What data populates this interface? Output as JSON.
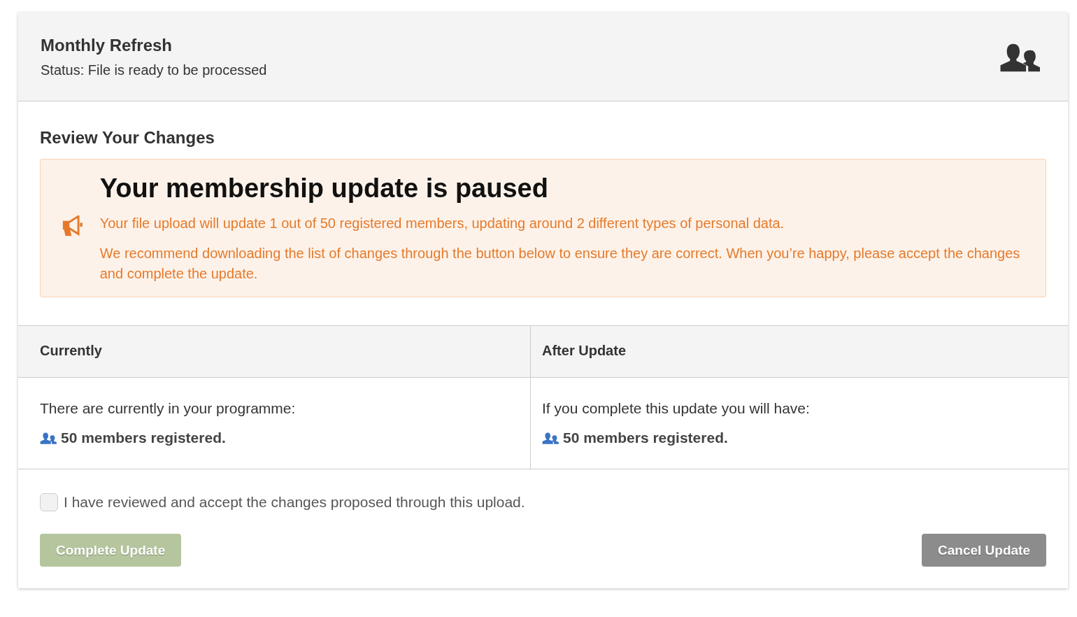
{
  "header": {
    "title": "Monthly Refresh",
    "status": "Status: File is ready to be processed"
  },
  "review": {
    "heading": "Review Your Changes",
    "alert": {
      "title": "Your membership update is paused",
      "paragraphs": [
        "Your file upload will update 1 out of 50 registered members, updating around 2 different types of personal data.",
        "We recommend downloading the list of changes through the button below to ensure they are correct. When you’re happy, please accept the changes and complete the update."
      ]
    }
  },
  "comparison": [
    {
      "heading": "Currently",
      "intro": "There are currently in your programme:",
      "count": "50 members registered."
    },
    {
      "heading": "After Update",
      "intro": "If you complete this update you will have:",
      "count": "50 members registered."
    }
  ],
  "confirm": {
    "label": "I have reviewed and accept the changes proposed through this upload.",
    "checked": false
  },
  "buttons": [
    {
      "label": "Complete Update",
      "kind": "primary",
      "disabled": true
    },
    {
      "label": "Cancel Update",
      "kind": "secondary",
      "disabled": false
    }
  ]
}
